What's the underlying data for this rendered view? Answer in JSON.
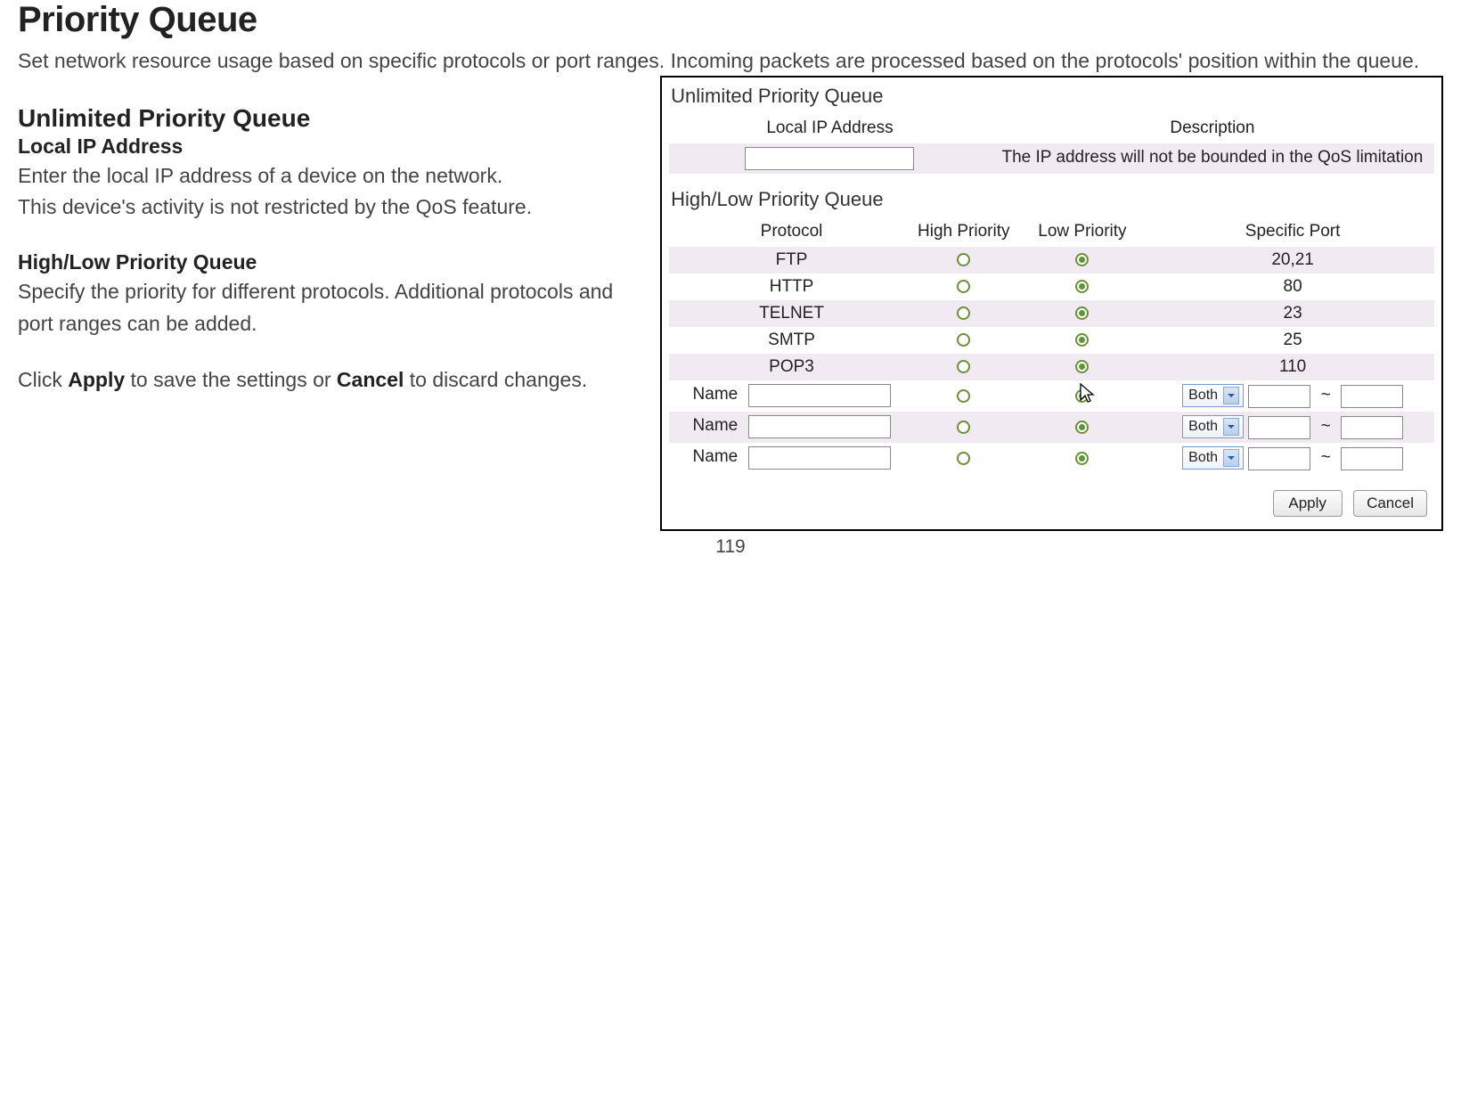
{
  "page": {
    "title": "Priority Queue",
    "intro": "Set network resource usage based on specific protocols or port ranges. Incoming packets are processed based on the protocols' position within the queue.",
    "number": "119"
  },
  "doc": {
    "unlimited_title": "Unlimited Priority Queue",
    "local_ip_heading": "Local IP Address",
    "local_ip_text1": "Enter the local IP address of a device on the network.",
    "local_ip_text2": "This device's activity is not restricted by the QoS feature.",
    "hl_title": "High/Low Priority Queue",
    "hl_text": "Specify the priority for different protocols. Additional protocols and port ranges can be added.",
    "apply_text_pre": "Click ",
    "apply_word": "Apply",
    "apply_text_mid": " to save the settings or ",
    "cancel_word": "Cancel",
    "apply_text_post": " to discard changes."
  },
  "panel": {
    "unlimited_heading": "Unlimited Priority Queue",
    "hl_heading": "High/Low Priority Queue",
    "unlimited_headers": {
      "ip": "Local IP Address",
      "desc": "Description"
    },
    "unlimited_desc": "The IP address will not be bounded in the QoS limitation",
    "hl_headers": {
      "protocol": "Protocol",
      "high": "High Priority",
      "low": "Low Priority",
      "port": "Specific Port"
    },
    "rows": [
      {
        "protocol": "FTP",
        "port": "20,21"
      },
      {
        "protocol": "HTTP",
        "port": "80"
      },
      {
        "protocol": "TELNET",
        "port": "23"
      },
      {
        "protocol": "SMTP",
        "port": "25"
      },
      {
        "protocol": "POP3",
        "port": "110"
      }
    ],
    "custom_label": "Name",
    "select_value": "Both",
    "apply": "Apply",
    "cancel": "Cancel"
  }
}
